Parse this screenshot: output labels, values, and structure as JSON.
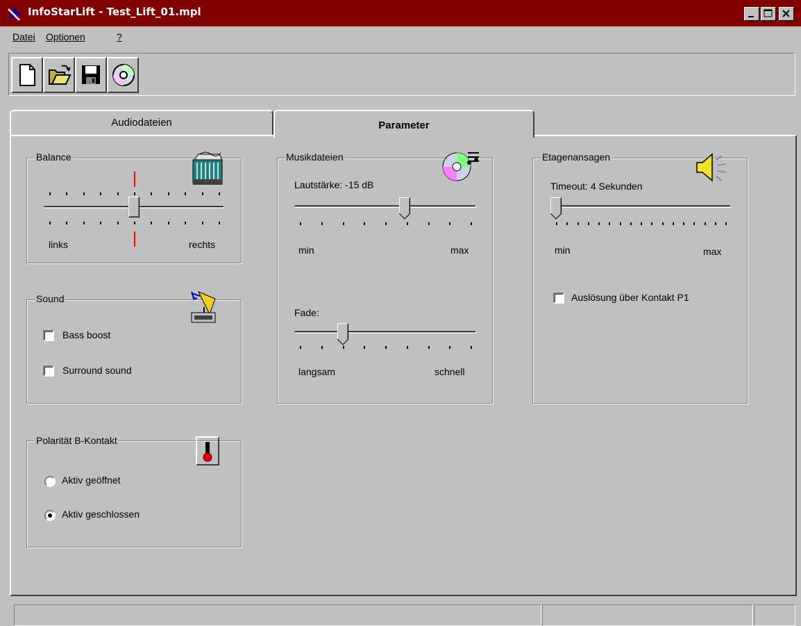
{
  "window": {
    "title": "InfoStarLift - Test_Lift_01.mpl"
  },
  "menu": {
    "datei": "Datei",
    "optionen": "Optionen",
    "help": "?"
  },
  "toolbar": {
    "buttons": [
      "new-file",
      "open-folder",
      "save-disk",
      "cd-audio"
    ]
  },
  "tabs": {
    "audiodateien": "Audiodateien",
    "parameter": "Parameter",
    "active": "Parameter"
  },
  "balance": {
    "title": "Balance",
    "left_label": "links",
    "right_label": "rechts",
    "value_fraction": 0.5
  },
  "sound": {
    "title": "Sound",
    "bass_boost": "Bass boost",
    "bass_checked": false,
    "surround": "Surround sound",
    "surround_checked": false
  },
  "polaritaet": {
    "title": "Polarität B-Kontakt",
    "opt1": "Aktiv geöffnet",
    "opt2": "Aktiv geschlossen",
    "selected": "Aktiv geschlossen"
  },
  "musik": {
    "title": "Musikdateien",
    "volume_label": "Lautstärke:  -15 dB",
    "volume_fraction": 0.615,
    "min": "min",
    "max": "max",
    "fade_label": "Fade:",
    "fade_fraction": 0.25,
    "fade_min": "langsam",
    "fade_max": "schnell"
  },
  "etagen": {
    "title": "Etagenansagen",
    "timeout_label": "Timeout:  4 Sekunden",
    "timeout_fraction": 0.0,
    "min": "min",
    "max": "max",
    "ausloesung": "Auslösung über Kontakt P1",
    "ausloesung_checked": false
  },
  "colors": {
    "titlebar": "#800000",
    "face": "#c0c0c0",
    "balance_marker": "#ff0000"
  }
}
